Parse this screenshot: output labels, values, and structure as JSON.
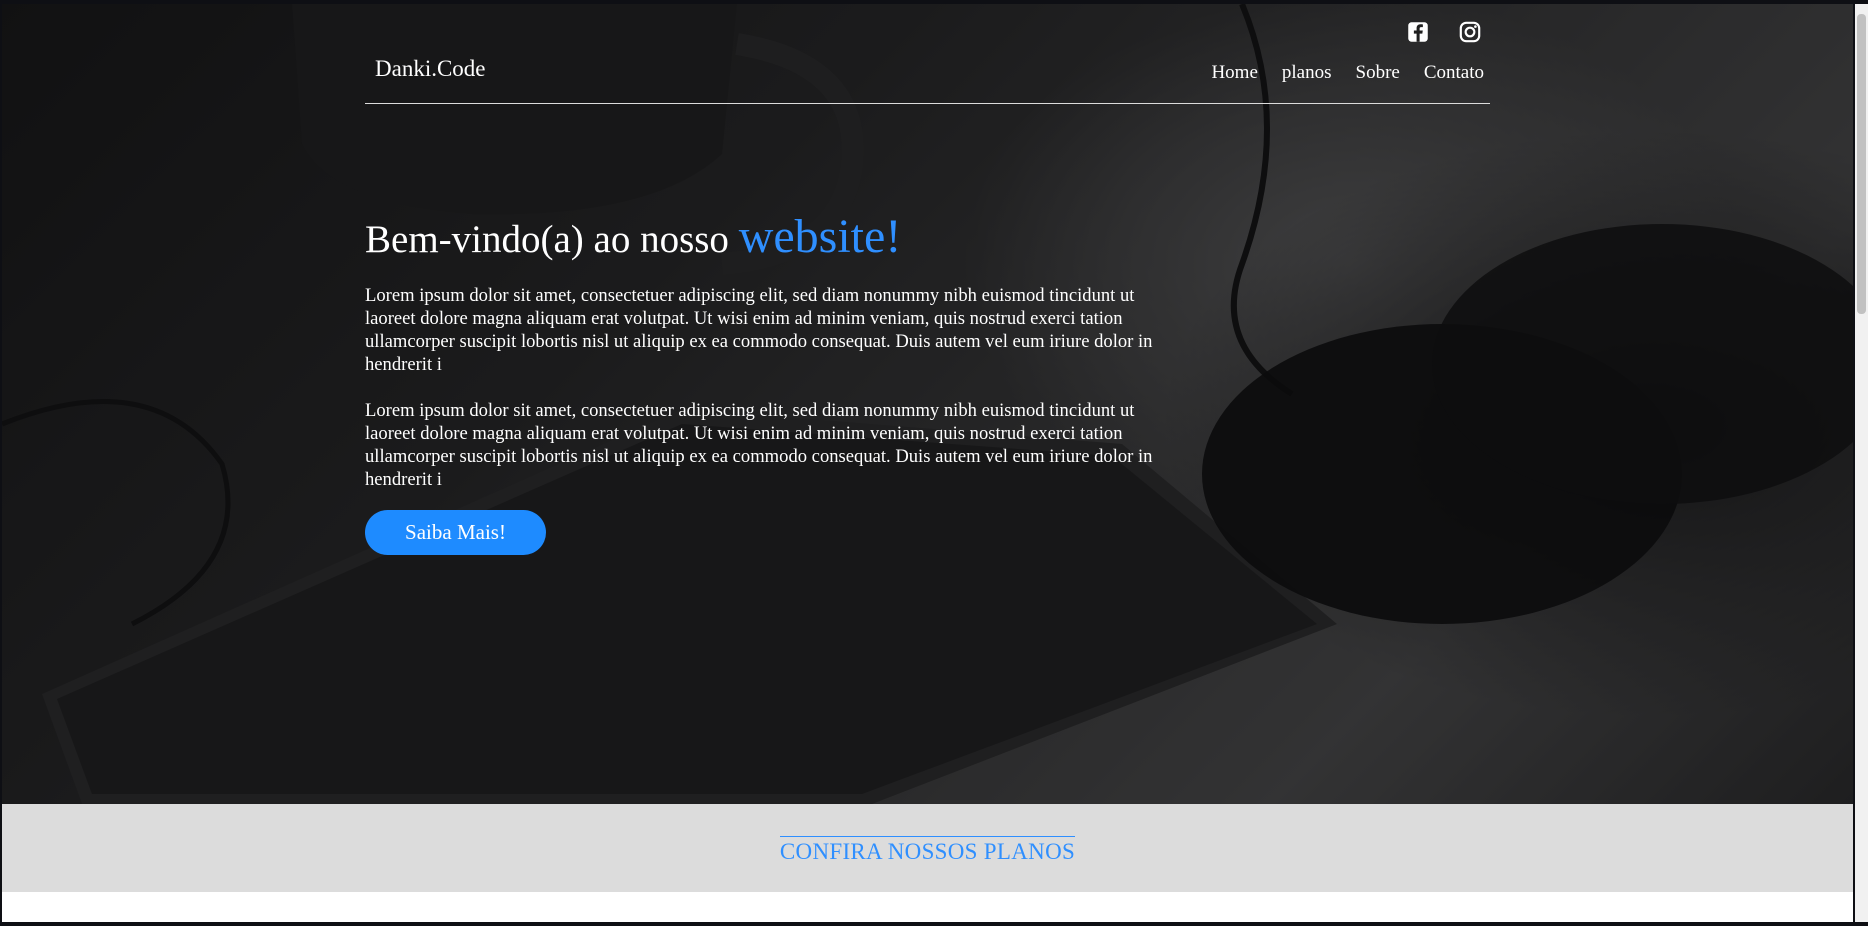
{
  "header": {
    "logo": "Danki.Code",
    "nav": [
      "Home",
      "planos",
      "Sobre",
      "Contato"
    ],
    "social_icons": [
      "facebook-icon",
      "instagram-icon"
    ]
  },
  "hero": {
    "headline_prefix": "Bem-vindo(a) ao nosso",
    "headline_accent": "website!",
    "paragraphs": [
      "Lorem ipsum dolor sit amet, consectetuer adipiscing elit, sed diam nonummy nibh euismod tincidunt ut laoreet dolore magna aliquam erat volutpat. Ut wisi enim ad minim veniam, quis nostrud exerci tation ullamcorper suscipit lobortis nisl ut aliquip ex ea commodo consequat. Duis autem vel eum iriure dolor in hendrerit i",
      "Lorem ipsum dolor sit amet, consectetuer adipiscing elit, sed diam nonummy nibh euismod tincidunt ut laoreet dolore magna aliquam erat volutpat. Ut wisi enim ad minim veniam, quis nostrud exerci tation ullamcorper suscipit lobortis nisl ut aliquip ex ea commodo consequat. Duis autem vel eum iriure dolor in hendrerit i"
    ],
    "button_label": "Saiba Mais!"
  },
  "plans": {
    "title": "CONFIRA NOSSOS PLANOS"
  },
  "colors": {
    "accent": "#2f8fff",
    "button": "#1e8bff",
    "section_bg": "#dcdcdc"
  }
}
